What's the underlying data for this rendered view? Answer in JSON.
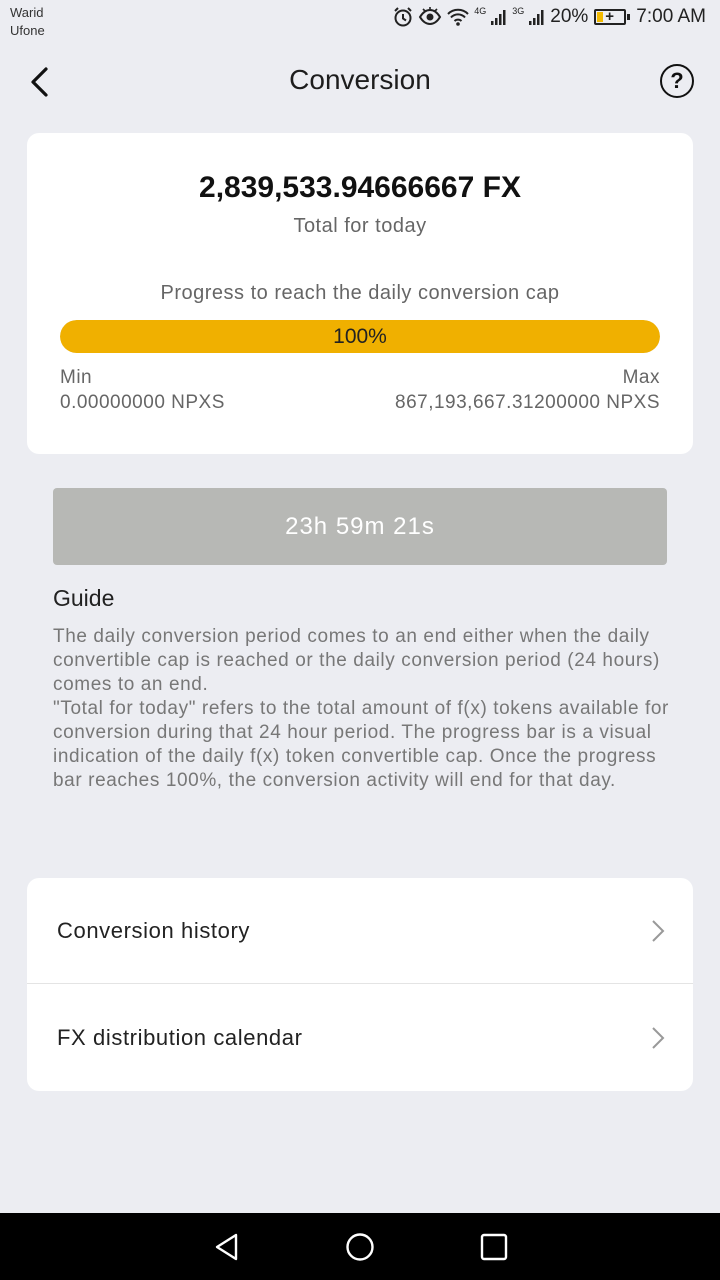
{
  "status_bar": {
    "carrier_1": "Warid",
    "carrier_2": "Ufone",
    "net_1": "4G",
    "net_2": "3G",
    "battery_percent": "20%",
    "battery_level": 0.2,
    "time": "7:00 AM",
    "icons": [
      "alarm-icon",
      "eye-icon",
      "wifi-icon",
      "signal-icon",
      "signal-icon",
      "battery-icon"
    ]
  },
  "header": {
    "title": "Conversion",
    "back_icon": "back-arrow-icon",
    "help_label": "?"
  },
  "summary": {
    "total_value": "2,839,533.94666667 FX",
    "total_label": "Total for today",
    "progress_label": "Progress to reach the daily conversion cap",
    "progress_text": "100%",
    "progress_value": 1.0,
    "min_label": "Min",
    "min_value": "0.00000000 NPXS",
    "max_label": "Max",
    "max_value": "867,193,667.31200000 NPXS"
  },
  "timer": {
    "label": "23h 59m 21s"
  },
  "guide": {
    "title": "Guide",
    "paragraph_1": "The daily conversion period comes to an end either when the daily convertible cap is reached or the daily conversion period (24 hours) comes to an end.",
    "paragraph_2": "\"Total for today\" refers to the total amount of f(x) tokens available for conversion during that 24 hour period. The progress bar is a visual indication of the daily f(x) token convertible cap. Once the progress bar reaches 100%, the conversion activity will end for that day."
  },
  "menu": {
    "items": [
      {
        "label": "Conversion history"
      },
      {
        "label": "FX distribution calendar"
      }
    ]
  },
  "colors": {
    "accent": "#f0b000",
    "background": "#ecedf2",
    "timer_button": "#b7b8b5"
  }
}
